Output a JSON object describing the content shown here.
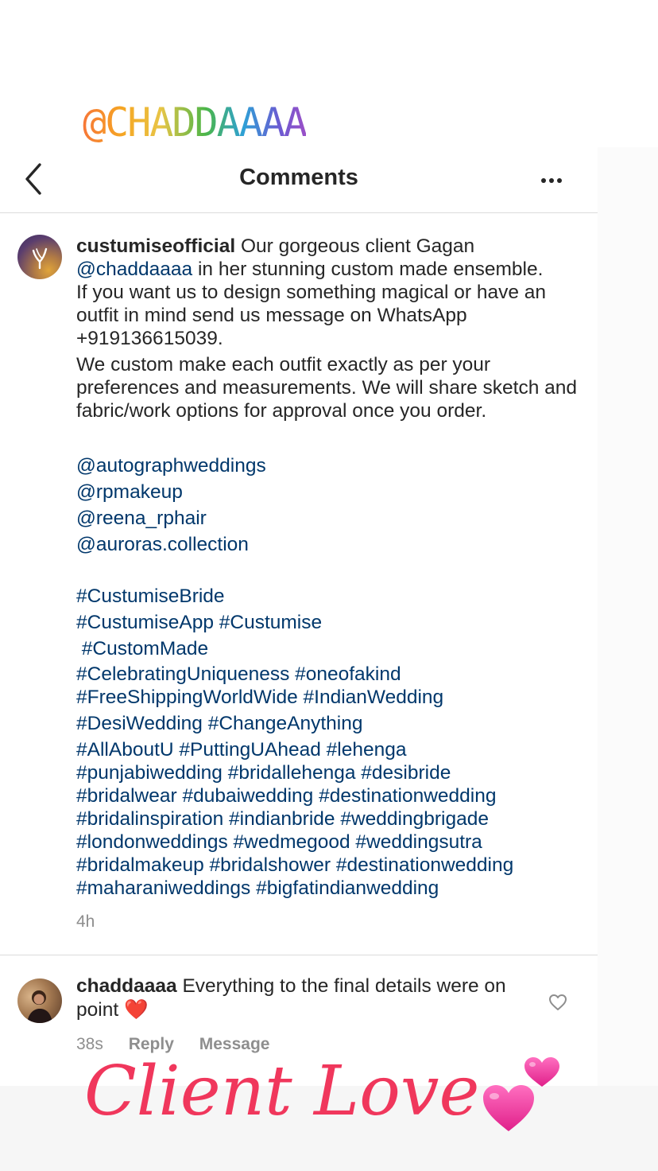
{
  "story": {
    "mention_sticker": "@CHADDAAAA",
    "overlay_text": "Client Love"
  },
  "header": {
    "title": "Comments",
    "back_icon": "chevron-left-icon",
    "more_icon": "more-horizontal-icon"
  },
  "caption": {
    "username": "custumiseofficial",
    "line1": "Our gorgeous client Gagan",
    "mention": "@chaddaaaa",
    "line1b": "in her stunning custom made ensemble.",
    "paragraph1": "If you want us to design something magical or have an outfit in mind send us message on WhatsApp +919136615039.",
    "paragraph2": "We custom make each outfit exactly as per your preferences and measurements. We will share sketch and fabric/work options for approval once you order.",
    "mentions": [
      "@autographweddings",
      "@rpmakeup",
      "@reena_rphair",
      "@auroras.collection"
    ],
    "hashtags_spaced": [
      "#CustumiseBride",
      "#CustumiseApp #Custumise",
      " #CustomMade"
    ],
    "hashtags_lines": [
      "#CelebratingUniqueness #oneofakind",
      "#FreeShippingWorldWide #IndianWedding",
      "#DesiWedding #ChangeAnything",
      "#AllAboutU #PuttingUAhead #lehenga",
      "#punjabiwedding #bridallehenga #desibride",
      "#bridalwear #dubaiwedding #destinationwedding",
      "#bridalinspiration #indianbride #weddingbrigade",
      "#londonweddings #wedmegood #weddingsutra",
      "#bridalmakeup #bridalshower #destinationwedding",
      "#maharaniweddings #bigfatindianwedding"
    ],
    "time": "4h"
  },
  "reply": {
    "username": "chaddaaaa",
    "text": "Everything to the final details were on point",
    "emoji": "❤️",
    "time": "38s",
    "reply_label": "Reply",
    "message_label": "Message"
  },
  "colors": {
    "link": "#00376b",
    "meta": "#8e8e8e",
    "overlay": "#f0375c"
  }
}
